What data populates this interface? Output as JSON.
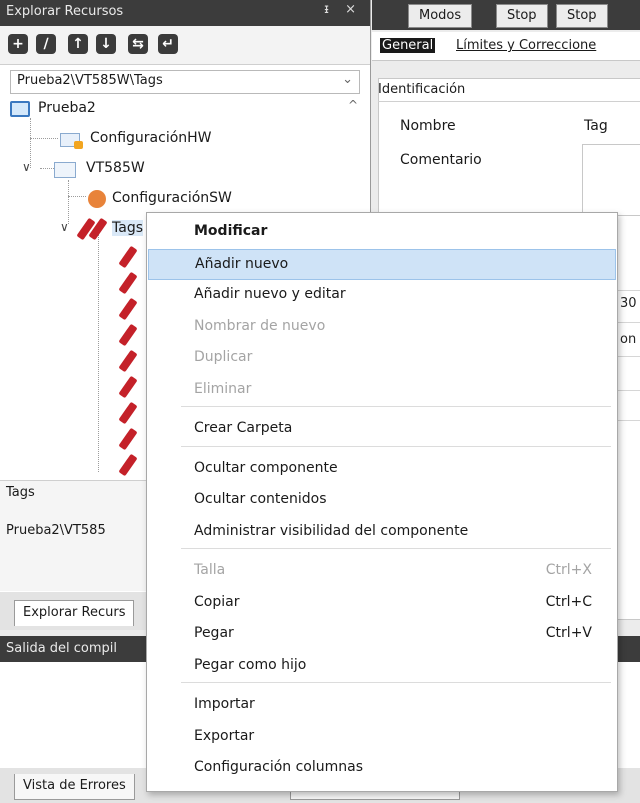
{
  "left_panel": {
    "title": "Explorar Recursos",
    "title_controls": "ᵻ ×",
    "toolbar": [
      "+",
      "∕",
      "↑",
      "↓",
      "⇆",
      "↵"
    ],
    "path": "Prueba2\\VT585W\\Tags",
    "tree": {
      "root": "Prueba2",
      "hw": "ConfiguraciónHW",
      "panel": "VT585W",
      "sw": "ConfiguraciónSW",
      "tags": "Tags"
    },
    "props_title": "Tags",
    "props_path": "Prueba2\\VT585",
    "tab": "Explorar Recurs"
  },
  "right_panel": {
    "mode_tabs": [
      "Modos",
      "Stop",
      "Stop"
    ],
    "sub_tabs": [
      "General",
      "Límites y Correccione"
    ],
    "section": "Identificación",
    "nombre_label": "Nombre",
    "nombre_value": "Tag",
    "comentario_label": "Comentario",
    "fragments": [
      "30",
      "on"
    ]
  },
  "output_panel": {
    "title": "Salida del compil",
    "tab": "Vista de Errores"
  },
  "context_menu": {
    "groups": [
      [
        {
          "label": "Modificar",
          "shortcut": "",
          "enabled": true,
          "bold": true
        },
        {
          "label": "Añadir nuevo",
          "shortcut": "",
          "enabled": true,
          "highlighted": true
        },
        {
          "label": "Añadir nuevo y editar",
          "shortcut": "",
          "enabled": true
        },
        {
          "label": "Nombrar de nuevo",
          "shortcut": "",
          "enabled": false
        },
        {
          "label": "Duplicar",
          "shortcut": "",
          "enabled": false
        },
        {
          "label": "Eliminar",
          "shortcut": "",
          "enabled": false
        }
      ],
      [
        {
          "label": "Crear Carpeta",
          "shortcut": "",
          "enabled": true
        }
      ],
      [
        {
          "label": "Ocultar componente",
          "shortcut": "",
          "enabled": true
        },
        {
          "label": "Ocultar contenidos",
          "shortcut": "",
          "enabled": true
        },
        {
          "label": "Administrar visibilidad del componente",
          "shortcut": "",
          "enabled": true
        }
      ],
      [
        {
          "label": "Talla",
          "shortcut": "Ctrl+X",
          "enabled": false
        },
        {
          "label": "Copiar",
          "shortcut": "Ctrl+C",
          "enabled": true
        },
        {
          "label": "Pegar",
          "shortcut": "Ctrl+V",
          "enabled": true
        },
        {
          "label": "Pegar como hijo",
          "shortcut": "",
          "enabled": true
        }
      ],
      [
        {
          "label": "Importar",
          "shortcut": "",
          "enabled": true
        },
        {
          "label": "Exportar",
          "shortcut": "",
          "enabled": true
        },
        {
          "label": "Configuración columnas",
          "shortcut": "",
          "enabled": true
        }
      ]
    ]
  },
  "colors": {
    "title_bar": "#3c3c3c",
    "highlight": "#cfe3f7",
    "tag_icon": "#c42129",
    "disabled_text": "#a4a4a4"
  }
}
